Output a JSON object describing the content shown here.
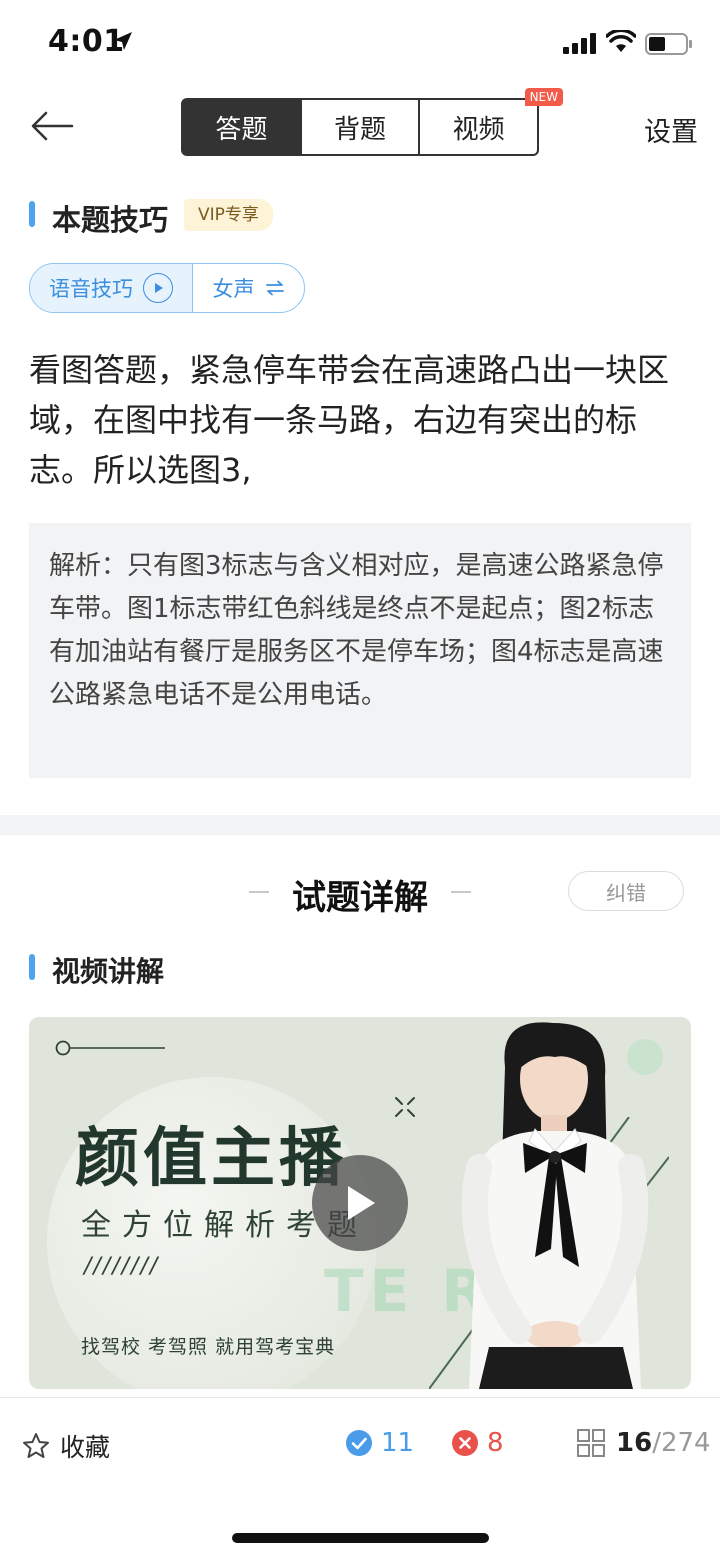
{
  "status": {
    "time": "4:01"
  },
  "nav": {
    "tabs": [
      {
        "label": "答题",
        "active": true
      },
      {
        "label": "背题",
        "active": false
      },
      {
        "label": "视频",
        "active": false,
        "badge": "NEW"
      }
    ],
    "settings": "设置"
  },
  "skill": {
    "title": "本题技巧",
    "vip_tag": "VIP专享",
    "voice_label": "语音技巧",
    "voice_gender": "女声",
    "text": "看图答题，紧急停车带会在高速路凸出一块区域，在图中找有一条马路，右边有突出的标志。所以选图3,",
    "analysis": "解析：只有图3标志与含义相对应，是高速公路紧急停车带。图1标志带红色斜线是终点不是起点；图2标志有加油站有餐厅是服务区不是停车场；图4标志是高速公路紧急电话不是公用电话。"
  },
  "detail": {
    "title": "试题详解",
    "report_label": "纠错",
    "video_section_title": "视频讲解",
    "video": {
      "headline": "颜值主播",
      "subline": "全方位解析考题",
      "slashes": "////////",
      "footer": "找驾校  考驾照  就用驾考宝典",
      "watermark": "TE      R"
    }
  },
  "bottom": {
    "favorite": "收藏",
    "correct": "11",
    "wrong": "8",
    "current": "16",
    "total": "/274"
  },
  "colors": {
    "accent": "#4da3ee",
    "correct": "#4a9be8",
    "wrong": "#e8524a",
    "badge": "#f35a4a"
  }
}
